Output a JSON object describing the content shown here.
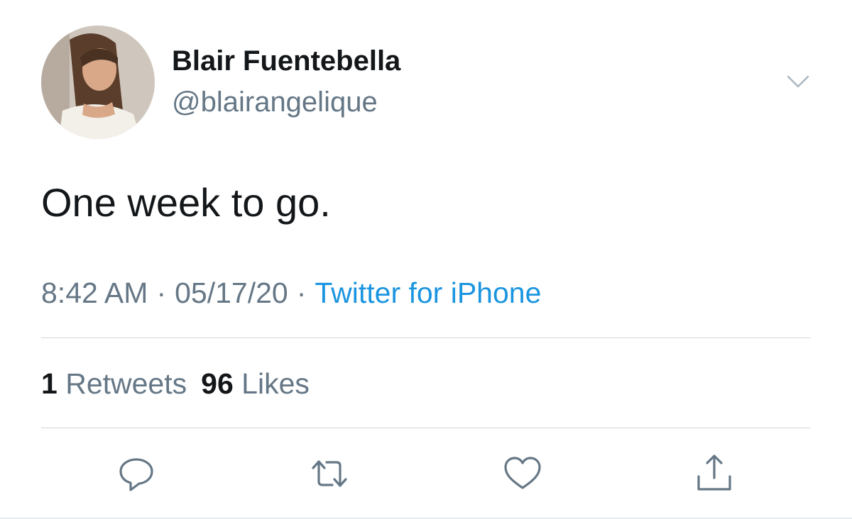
{
  "user": {
    "display_name": "Blair Fuentebella",
    "handle": "@blairangelique"
  },
  "tweet": {
    "text": "One week to go.",
    "time": "8:42 AM",
    "separator": "·",
    "date": "05/17/20",
    "source": "Twitter for iPhone"
  },
  "stats": {
    "retweets_count": "1",
    "retweets_label": "Retweets",
    "likes_count": "96",
    "likes_label": "Likes"
  },
  "actions": {
    "reply_icon": "speech-bubble",
    "retweet_icon": "retweet-arrows",
    "like_icon": "heart",
    "share_icon": "share-arrow"
  },
  "colors": {
    "text_primary": "#14171a",
    "text_secondary": "#657786",
    "link": "#1b95e0",
    "divider": "#d3d6da"
  }
}
